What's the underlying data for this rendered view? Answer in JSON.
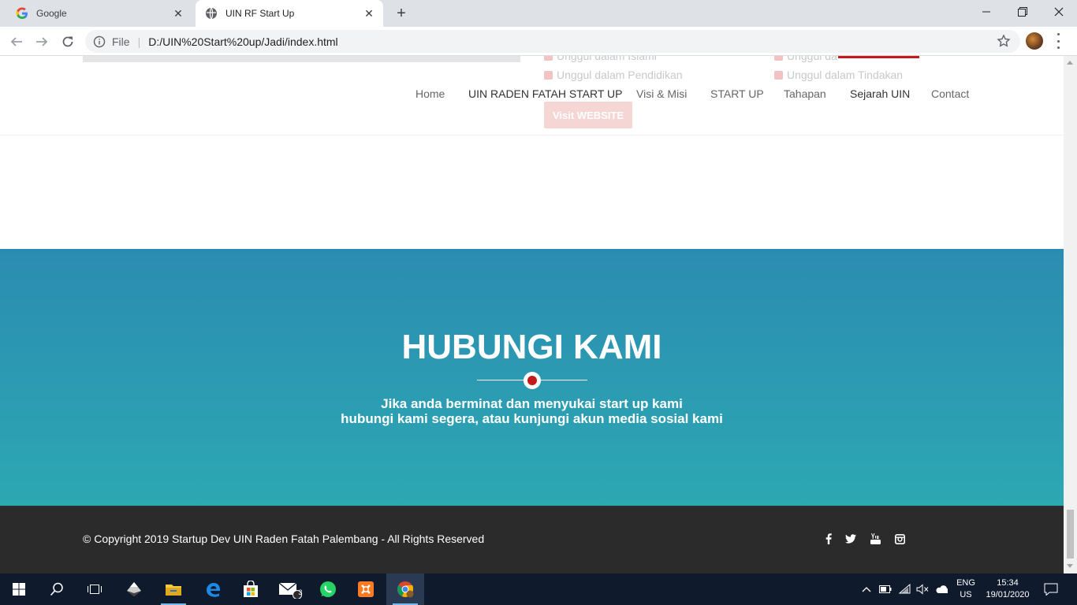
{
  "browser": {
    "tabs": [
      {
        "title": "Google"
      },
      {
        "title": "UIN RF Start Up"
      }
    ],
    "scheme_label": "File",
    "separator": "|",
    "url": "D:/UIN%20Start%20up/Jadi/index.html"
  },
  "ghost": {
    "items": [
      "Unggul dalam Islami",
      "Unggul dalam Pendidikan",
      "Unggul da",
      "Unggul dalam Tindakan"
    ],
    "button": "Visit WEBSITE"
  },
  "nav": {
    "items": [
      "Home",
      "UIN RADEN FATAH START UP",
      "Visi & Misi",
      "START UP",
      "Tahapan",
      "Sejarah UIN",
      "Contact"
    ]
  },
  "contact": {
    "title": "HUBUNGI KAMI",
    "line1": "Jika anda berminat dan menyukai start up kami",
    "line2": "hubungi kami segera, atau kunjungi akun media sosial kami",
    "accent_color": "#c41a1a",
    "bg_top": "#2b8cb2",
    "bg_bottom": "#2ca8b2"
  },
  "footer": {
    "copyright": "© Copyright 2019 Startup Dev UIN Raden Fatah Palembang - All Rights Reserved",
    "social": [
      "facebook-icon",
      "twitter-icon",
      "youtube-icon",
      "instagram-icon"
    ]
  },
  "taskbar": {
    "mail_badge": "3",
    "lang_top": "ENG",
    "lang_bottom": "US",
    "time": "15:34",
    "date": "19/01/2020"
  }
}
